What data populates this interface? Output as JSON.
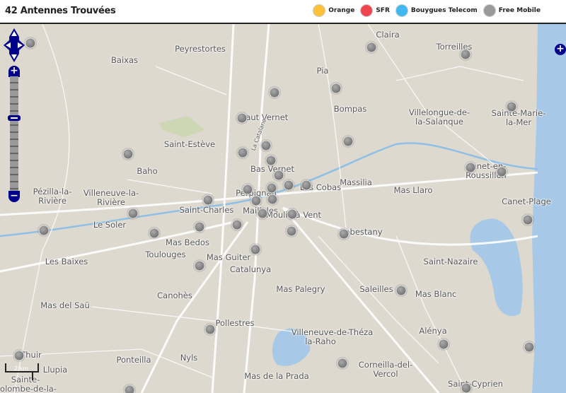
{
  "header": {
    "title": "42 Antennes Trouvées"
  },
  "legend": [
    {
      "label": "Orange",
      "color": "#ffc13a"
    },
    {
      "label": "SFR",
      "color": "#f0444f"
    },
    {
      "label": "Bouygues Telecom",
      "color": "#42b8f0"
    },
    {
      "label": "Free Mobile",
      "color": "#9a9a9a"
    }
  ],
  "map": {
    "places": [
      "Claira",
      "Peyrestortes",
      "Baixas",
      "Torreilles",
      "Pia",
      "Bompas",
      "Villelongue-de-la-Salanque",
      "Sainte-Marie-la-Mer",
      "Haut Vernet",
      "Saint-Estève",
      "Bas Vernet",
      "Baho",
      "Canet-en-Roussillon",
      "Massilia",
      "Mas Llaro",
      "Perpignan",
      "Les Cobas",
      "Pézilla-la-Rivière",
      "Villeneuve-la-Rivière",
      "Saint-Charles",
      "Mailloles",
      "Moulin à Vent",
      "Canet-Plage",
      "Le Soler",
      "Cabestany",
      "Mas Bedos",
      "Toulouges",
      "Mas Guiter",
      "Catalunya",
      "Saint-Nazaire",
      "Les Baixes",
      "Mas Palegry",
      "Saleilles",
      "Mas Blanc",
      "Canohès",
      "Mas del Saü",
      "Pollestres",
      "Villeneuve-de-la-Raho",
      "Théza",
      "Alénya",
      "Thuir",
      "Llupia",
      "Ponteilla",
      "Nyls",
      "Corneilla-del-Vercol",
      "Mas de la Prada",
      "Saint-Cyprien",
      "Sainte-Colombe-de-la-",
      "Saleilles",
      "La Catalane"
    ],
    "scale_label": "2 km",
    "zoom_in": "+",
    "zoom_out": "−",
    "layer_switcher": "+"
  }
}
